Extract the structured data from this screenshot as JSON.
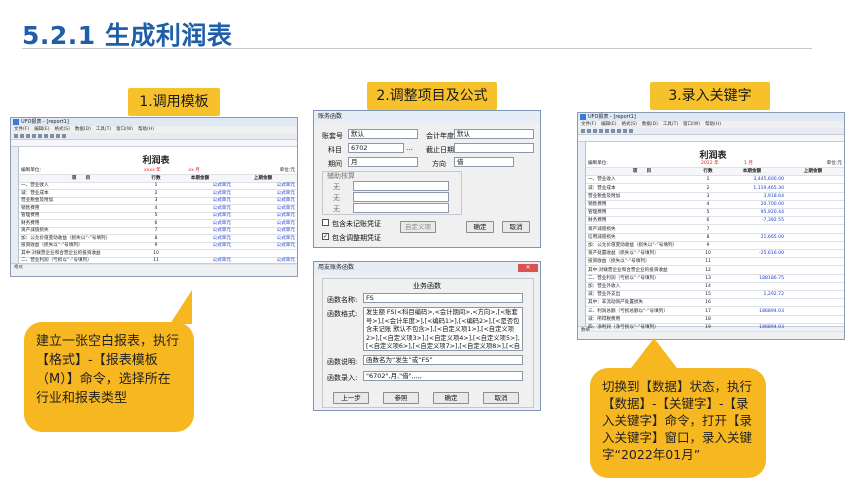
{
  "page": {
    "title": "5.2.1 生成利润表"
  },
  "steps": [
    {
      "label": "1.调用模板"
    },
    {
      "label": "2.调整项目及公式"
    },
    {
      "label": "3.录入关键字"
    }
  ],
  "callouts": {
    "left": "建立一张空白报表，执行【格式】-【报表模板（M）】命令，选择所在行业和报表类型",
    "right": "切换到【数据】状态，执行【数据】-【关键字】-【录入关键字】命令，打开【录入关键字】窗口，录入关键字“2022年01月”"
  },
  "window1": {
    "title": "UFO报表 - [report1]",
    "menu": [
      "文件(F)",
      "编辑(E)",
      "格式(S)",
      "数据(D)",
      "工具(T)",
      "窗口(W)",
      "帮助(H)"
    ],
    "sheet_title": "利润表",
    "unit": "会企02表",
    "company": "编制单位:",
    "year_mark": "xxxx 年",
    "month_mark": "xx 月",
    "currency": "单位:元",
    "headers": [
      "项　　目",
      "行数",
      "本期金额",
      "上期金额"
    ],
    "rows": [
      {
        "item": "一、营业收入",
        "no": "1",
        "cur": "公式单元",
        "prev": "公式单元"
      },
      {
        "item": "减：营业成本",
        "no": "2",
        "cur": "公式单元",
        "prev": "公式单元"
      },
      {
        "item": "营业税金及附加",
        "no": "3",
        "cur": "公式单元",
        "prev": "公式单元"
      },
      {
        "item": "销售费用",
        "no": "4",
        "cur": "公式单元",
        "prev": "公式单元"
      },
      {
        "item": "管理费用",
        "no": "5",
        "cur": "公式单元",
        "prev": "公式单元"
      },
      {
        "item": "财务费用",
        "no": "6",
        "cur": "公式单元",
        "prev": "公式单元"
      },
      {
        "item": "资产减值损失",
        "no": "7",
        "cur": "公式单元",
        "prev": "公式单元"
      },
      {
        "item": "加：公允价值变动收益（损失以“-”号填列）",
        "no": "8",
        "cur": "公式单元",
        "prev": "公式单元"
      },
      {
        "item": "投资收益（损失以“-”号填列）",
        "no": "9",
        "cur": "公式单元",
        "prev": "公式单元"
      },
      {
        "item": "其中:对联营企业和合营企业的投资收益",
        "no": "10",
        "cur": "",
        "prev": ""
      },
      {
        "item": "二、营业利润（亏损以“-”号填列）",
        "no": "11",
        "cur": "公式单元",
        "prev": "公式单元"
      }
    ],
    "status": "格式"
  },
  "dialog_fn": {
    "title": "账务函数",
    "account_set_label": "账套号",
    "account_set_value": "默认",
    "year_label": "会计年度",
    "year_value": "默认",
    "subject_label": "科目",
    "subject_value": "6702",
    "end_date_label": "截止日期",
    "period_label": "期间",
    "period_value": "月",
    "direction_label": "方向",
    "direction_value": "借",
    "aux_label": "辅助核算",
    "aux_none": "无",
    "chk_unposted": "包含未记账凭证",
    "chk_adjust": "包含调整期凭证",
    "btn_custom": "自定义项",
    "btn_ok": "确定",
    "btn_cancel": "取消"
  },
  "dialog_biz": {
    "title": "用友账务函数",
    "heading": "业务函数",
    "name_label": "函数名称:",
    "name_value": "FS",
    "format_label": "函数格式:",
    "format_value": "发生额 FS(<科目编码>,<会计期间>,<方向>,[<账套号>],[<会计年度>],[<编码1>],[<编码2>],[<是否包含未记账 默认不包含>],[<自定义项1>],[<自定义项2>],[<自定义项3>],[<自定义项4>],[<自定义项5>],[<自定义项6>],[<自定义项7>],[<自定义项8>],[<自定义项9>],[<自定义项10>],[<自定义项11>],[<自定义项12>],[<自定义项13>],[<自定义",
    "desc_label": "函数说明:",
    "desc_value": "函数名为“发生”或“FS”",
    "input_label": "函数录入:",
    "input_value": "\"6702\",月,\"借\",,,,,",
    "btn_prev": "上一步",
    "btn_ref": "参照",
    "btn_ok": "确定",
    "btn_cancel": "取消"
  },
  "window3": {
    "title": "UFO报表 - [report1]",
    "menu": [
      "文件(F)",
      "编辑(E)",
      "格式(S)",
      "数据(D)",
      "工具(T)",
      "窗口(W)",
      "帮助(H)"
    ],
    "sheet_title": "利润表",
    "unit": "会企02表",
    "company": "编制单位:",
    "year_mark": "2022 年",
    "month_mark": "1 月",
    "currency": "单位:元",
    "headers": [
      "项　　目",
      "行数",
      "本期金额",
      "上期金额"
    ],
    "rows": [
      {
        "item": "一、营业收入",
        "no": "1",
        "cur": "3,445,600.00"
      },
      {
        "item": "减：营业成本",
        "no": "2",
        "cur": "1,119,465.30"
      },
      {
        "item": "营业税金及附加",
        "no": "3",
        "cur": "3,918.64"
      },
      {
        "item": "销售费用",
        "no": "4",
        "cur": "20,700.00"
      },
      {
        "item": "管理费用",
        "no": "5",
        "cur": "95,920.44"
      },
      {
        "item": "财务费用",
        "no": "6",
        "cur": "-7,392.55"
      },
      {
        "item": "资产减值损失",
        "no": "7",
        "cur": ""
      },
      {
        "item": "信用减值损失",
        "no": "8",
        "cur": "21,665.00"
      },
      {
        "item": "加：公允价值变动收益（损失以“-”号填列）",
        "no": "9",
        "cur": ""
      },
      {
        "item": "资产处置收益（损失以“-”号填列）",
        "no": "10",
        "cur": "-25,616.00"
      },
      {
        "item": "投资收益（损失以“-”号填列）",
        "no": "11",
        "cur": ""
      },
      {
        "item": "其中:对联营企业和合营企业的投资收益",
        "no": "12",
        "cur": ""
      },
      {
        "item": "二、营业利润（亏损以“-”号填列）",
        "no": "13",
        "cur": "188186.75"
      },
      {
        "item": "加：营业外收入",
        "no": "14",
        "cur": ""
      },
      {
        "item": "减：营业外支出",
        "no": "15",
        "cur": "1,292.72"
      },
      {
        "item": "其中：非流动资产处置损失",
        "no": "16",
        "cur": ""
      },
      {
        "item": "三、利润总额（亏损总额以“-”号填列）",
        "no": "17",
        "cur": "186894.03"
      },
      {
        "item": "减：所得税费用",
        "no": "18",
        "cur": ""
      },
      {
        "item": "四、净利润（净亏损以“-”号填列）",
        "no": "19",
        "cur": "186894.03"
      }
    ],
    "status": "数据"
  }
}
